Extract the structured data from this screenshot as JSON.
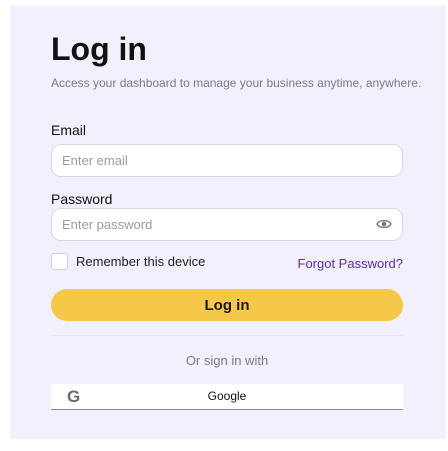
{
  "login": {
    "title": "Log in",
    "subtitle": "Access your dashboard to manage your business anytime, anywhere.",
    "email": {
      "label": "Email",
      "placeholder": "Enter email",
      "value": ""
    },
    "password": {
      "label": "Password",
      "placeholder": "Enter password",
      "value": "",
      "toggle_icon": "eye-icon"
    },
    "remember": {
      "label": "Remember this device",
      "checked": false
    },
    "forgot_label": "Forgot Password?",
    "submit_label": "Log in",
    "alt_signin_text": "Or sign in with",
    "google": {
      "icon": "google-icon",
      "label": "Google"
    }
  },
  "colors": {
    "card_background": "#f3f0fd",
    "primary_button": "#f5c84a",
    "link": "#5b2ca8",
    "muted_text": "#7b7b85"
  }
}
